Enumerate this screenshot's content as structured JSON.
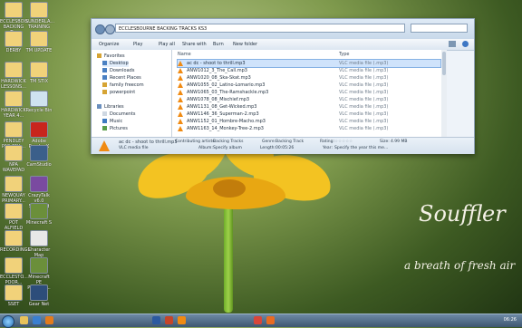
{
  "desktop": {
    "icons": [
      {
        "label": "ECCLESBOU... BACKING T..."
      },
      {
        "label": "SUNDERLA... TRAINING"
      },
      {
        "label": "DERBY"
      },
      {
        "label": "TM UPDATE"
      },
      {
        "label": "HARDWICK LESSONS..."
      },
      {
        "label": "TM STIX"
      },
      {
        "label": "HARDWICK YEAR 4..."
      },
      {
        "label": "Recycle Bin"
      },
      {
        "label": "PENDLEY PAS ONL..."
      },
      {
        "label": "Adobe Reader X"
      },
      {
        "label": "NPA WAVEPAD"
      },
      {
        "label": "CamStudio"
      },
      {
        "label": "NEWQUAY PRIMARY..."
      },
      {
        "label": "CrazyTalk v6.0 Standard"
      },
      {
        "label": "POT ALFIELD"
      },
      {
        "label": "Minecraft S"
      },
      {
        "label": "RECORDINGS"
      },
      {
        "label": "Character Map"
      },
      {
        "label": "ECCLESTO... POOR..."
      },
      {
        "label": "Minecraft PE Portable..."
      },
      {
        "label": "SSET"
      },
      {
        "label": "Gear Net"
      }
    ],
    "wallpaper_text": {
      "title": "Souffler",
      "subtitle": "a breath of fresh air"
    }
  },
  "explorer": {
    "address": "ECCLESBOURNE  BACKING TRACKS KS3",
    "search_placeholder": "",
    "toolbar": {
      "organize": "Organize",
      "play": "Play",
      "play_all": "Play all",
      "share_with": "Share with",
      "burn": "Burn",
      "new_folder": "New folder"
    },
    "nav_items": [
      {
        "label": "Favorites"
      },
      {
        "label": "Desktop"
      },
      {
        "label": "Downloads"
      },
      {
        "label": "Recent Places"
      },
      {
        "label": "family freecom"
      },
      {
        "label": "powerpoint"
      },
      {
        "label": "Libraries"
      },
      {
        "label": "Documents"
      },
      {
        "label": "Music"
      },
      {
        "label": "Pictures"
      }
    ],
    "columns": {
      "name": "Name",
      "type": "Type"
    },
    "files": [
      {
        "name": "ac dc - shoot to thrill.mp3",
        "type": "VLC media file (.mp3)",
        "selected": true
      },
      {
        "name": "ANW1012_3_The_Call.mp3",
        "type": "VLC media file (.mp3)"
      },
      {
        "name": "ANW1020_08_Ska-Skat.mp3",
        "type": "VLC media file (.mp3)"
      },
      {
        "name": "ANW1055_02_Latino-Lomario.mp3",
        "type": "VLC media file (.mp3)"
      },
      {
        "name": "ANW1065_03_The-Ramshackle.mp3",
        "type": "VLC media file (.mp3)"
      },
      {
        "name": "ANW1078_08_Mischief.mp3",
        "type": "VLC media file (.mp3)"
      },
      {
        "name": "ANW1131_08_Get-Wicked.mp3",
        "type": "VLC media file (.mp3)"
      },
      {
        "name": "ANW1146_36_Superman-2.mp3",
        "type": "VLC media file (.mp3)"
      },
      {
        "name": "ANW1152_01_Hombre-Macho.mp3",
        "type": "VLC media file (.mp3)"
      },
      {
        "name": "ANW1163_14_Monkey-Tree-2.mp3",
        "type": "VLC media file (.mp3)"
      }
    ],
    "details": {
      "title": "ac dc - shoot to thrill.mp3",
      "file_type": "VLC media file",
      "contributing_artists_label": "Contributing artists:",
      "contributing_artists": "Backing Tracks",
      "album_label": "Album:",
      "album": "Specify album",
      "genre_label": "Genre:",
      "genre": "Backing Track",
      "length_label": "Length:",
      "length": "00:05:26",
      "rating_label": "Rating:",
      "year_label": "Year:",
      "year": "Specify the year this me...",
      "size_label": "Size:",
      "size": "4.99 MB"
    }
  },
  "taskbar": {
    "clock": "06:26"
  }
}
